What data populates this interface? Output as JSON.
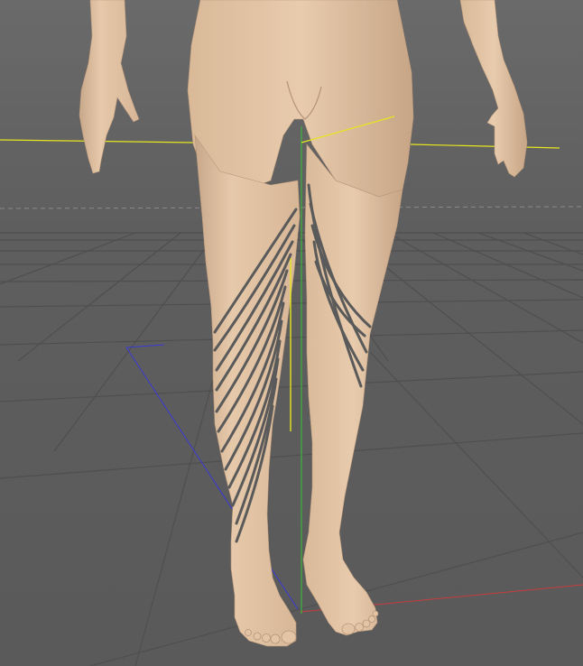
{
  "viewport": {
    "kind": "3D viewport",
    "background_color": "#5f5f5f",
    "grid_color": "#4d4d4d",
    "model_skin_color": "#e3c4a4",
    "spline_color": "#5a5a5a"
  },
  "axes": {
    "x_color": "#c83c3c",
    "y_color": "#3cb43c",
    "z_color": "#3c3cd2",
    "bone_color": "#e6e61e",
    "horizon_color": "#8a8a8a"
  },
  "icons": {
    "model": "female-figure-legs",
    "splines": "hair-strand-curves"
  }
}
